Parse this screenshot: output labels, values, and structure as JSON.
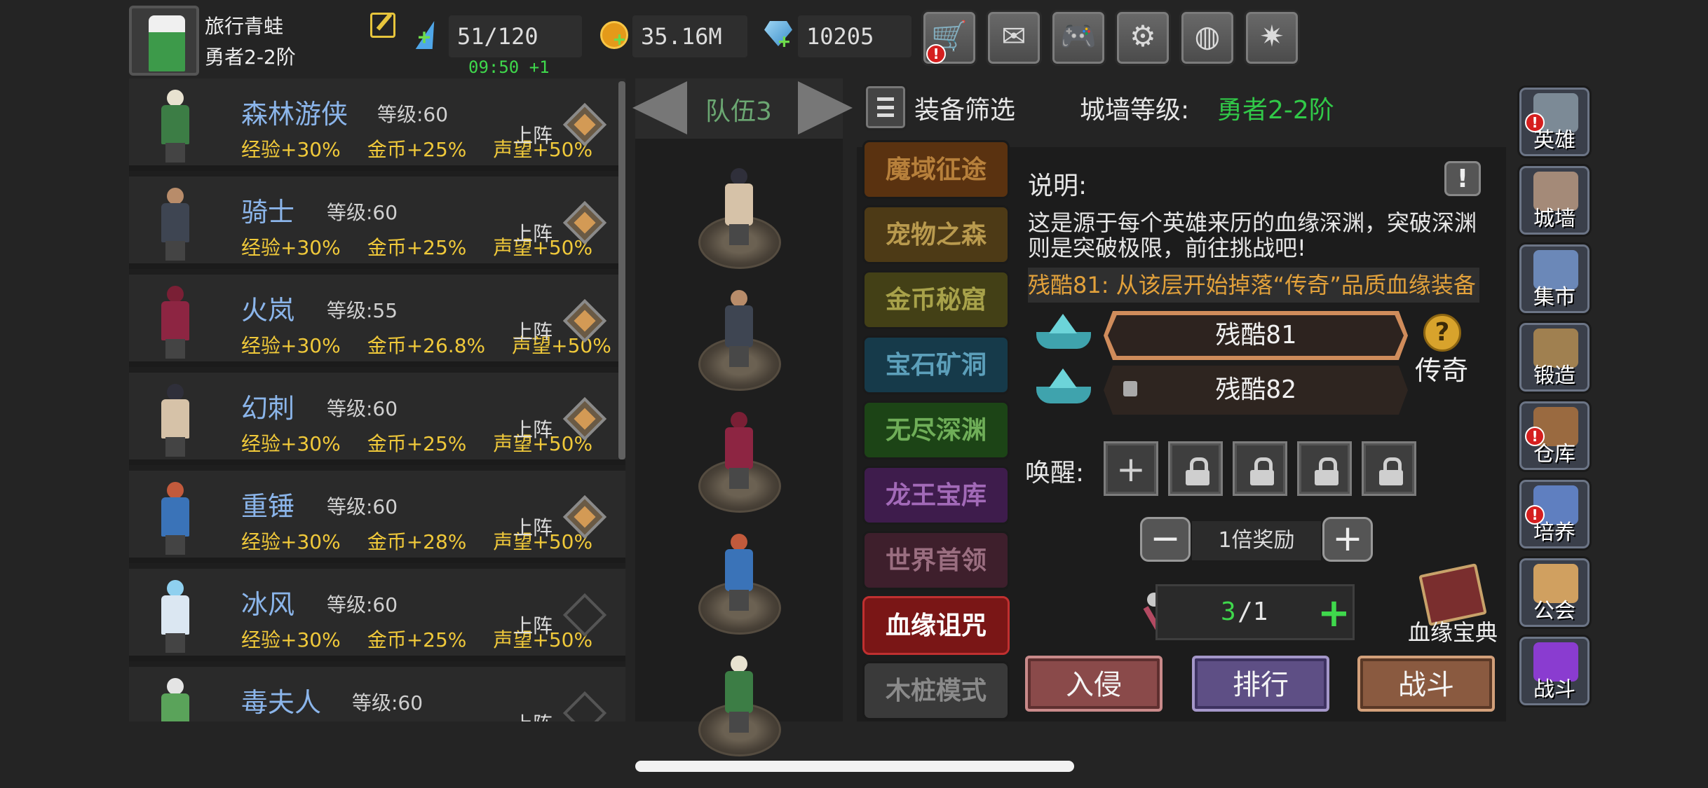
{
  "player": {
    "name": "旅行青蛙",
    "rank": "勇者2-2阶"
  },
  "resources": {
    "energy": "51/120",
    "timer": "09:50 +1",
    "gold": "35.16M",
    "gems": "10205"
  },
  "top_buttons": [
    {
      "name": "shop-cart-icon",
      "glyph": "🛒",
      "badge": "!"
    },
    {
      "name": "mail-icon",
      "glyph": "✉"
    },
    {
      "name": "gamepad-icon",
      "glyph": "🎮"
    },
    {
      "name": "settings-icon",
      "glyph": "⚙"
    },
    {
      "name": "color-wheel-icon",
      "glyph": "◍"
    },
    {
      "name": "fireworks-icon",
      "glyph": "✷"
    }
  ],
  "heroes": [
    {
      "name": "森林游侠",
      "level": "等级:60",
      "exp": "经验+30%",
      "gold": "金币+25%",
      "fame": "声望+50%",
      "deploy": "上阵",
      "deployed": true,
      "head": "#e8e2d0",
      "body": "#3c7d45"
    },
    {
      "name": "骑士",
      "level": "等级:60",
      "exp": "经验+30%",
      "gold": "金币+25%",
      "fame": "声望+50%",
      "deploy": "上阵",
      "deployed": true,
      "head": "#b88c6a",
      "body": "#3e4552"
    },
    {
      "name": "火岚",
      "level": "等级:55",
      "exp": "经验+30%",
      "gold": "金币+26.8%",
      "fame": "声望+50%",
      "deploy": "上阵",
      "deployed": true,
      "head": "#7a1f35",
      "body": "#8d2542"
    },
    {
      "name": "幻刺",
      "level": "等级:60",
      "exp": "经验+30%",
      "gold": "金币+25%",
      "fame": "声望+50%",
      "deploy": "上阵",
      "deployed": true,
      "head": "#2f2f3a",
      "body": "#d6c2a8"
    },
    {
      "name": "重锤",
      "level": "等级:60",
      "exp": "经验+30%",
      "gold": "金币+28%",
      "fame": "声望+50%",
      "deploy": "上阵",
      "deployed": true,
      "head": "#c25a3c",
      "body": "#3a73b8"
    },
    {
      "name": "冰风",
      "level": "等级:60",
      "exp": "经验+30%",
      "gold": "金币+25%",
      "fame": "声望+50%",
      "deploy": "上阵",
      "deployed": false,
      "head": "#8fd0ef",
      "body": "#dbe7f2"
    },
    {
      "name": "毒夫人",
      "level": "等级:60",
      "exp": "",
      "gold": "",
      "fame": "",
      "deploy": "上阵",
      "deployed": false,
      "head": "#e4e4e4",
      "body": "#5aa35a"
    }
  ],
  "team": {
    "label": "队伍3",
    "members": [
      {
        "head": "#2f2f3a",
        "body": "#d6c2a8"
      },
      {
        "head": "#b88c6a",
        "body": "#3e4552"
      },
      {
        "head": "#7a1f35",
        "body": "#8d2542"
      },
      {
        "head": "#c25a3c",
        "body": "#3a73b8"
      },
      {
        "head": "#e8e2d0",
        "body": "#3c7d45"
      }
    ]
  },
  "panel": {
    "filter_label": "装备筛选",
    "wall_label": "城墙等级:",
    "wall_value": "勇者2-2阶",
    "desc_title": "说明:",
    "desc_text": "这是源于每个英雄来历的血缘深渊，突破深渊则是突破极限，前往挑战吧!",
    "highlight": "残酷81: 从该层开始掉落“传奇”品质血缘装备",
    "difficulties": [
      {
        "label": "残酷81",
        "selected": true
      },
      {
        "label": "残酷82",
        "selected": false,
        "locked": true
      }
    ],
    "rarity": "传奇",
    "help": "?",
    "awaken_label": "唤醒:",
    "awaken_add": "+",
    "reward_minus": "−",
    "reward_plus": "+",
    "reward_label": "1倍奖励",
    "counter_current": "3",
    "counter_rest": "/1",
    "counter_plus": "+",
    "book_label": "血缘宝典",
    "actions": [
      "入侵",
      "排行",
      "战斗"
    ]
  },
  "modes": [
    {
      "label": "魔域征途",
      "bg": "#5a3210",
      "fg": "#b7803b"
    },
    {
      "label": "宠物之森",
      "bg": "#4d3a16",
      "fg": "#b99a4e"
    },
    {
      "label": "金币秘窟",
      "bg": "#434016",
      "fg": "#a8a24a"
    },
    {
      "label": "宝石矿洞",
      "bg": "#163a4a",
      "fg": "#5c9fba"
    },
    {
      "label": "无尽深渊",
      "bg": "#1c4416",
      "fg": "#6fae58"
    },
    {
      "label": "龙王宝库",
      "bg": "#3e1c4c",
      "fg": "#a26ab8"
    },
    {
      "label": "世界首领",
      "bg": "#3e1f2c",
      "fg": "#9a6e80"
    },
    {
      "label": "血缘诅咒",
      "bg": "#7a1616",
      "fg": "#ffffff"
    },
    {
      "label": "木桩模式",
      "bg": "#3a3a3a",
      "fg": "#8a8a8a"
    }
  ],
  "side_nav": [
    {
      "label": "英雄",
      "badge": true,
      "color": "#7c8a96"
    },
    {
      "label": "城墙",
      "badge": false,
      "color": "#a48a78"
    },
    {
      "label": "集市",
      "badge": false,
      "color": "#6b88b8"
    },
    {
      "label": "锻造",
      "badge": false,
      "color": "#a08050"
    },
    {
      "label": "仓库",
      "badge": true,
      "color": "#9a6a40"
    },
    {
      "label": "培养",
      "badge": true,
      "color": "#5f7fc0"
    },
    {
      "label": "公会",
      "badge": false,
      "color": "#d0a060"
    },
    {
      "label": "战斗",
      "badge": false,
      "color": "#8a3cd0"
    }
  ]
}
